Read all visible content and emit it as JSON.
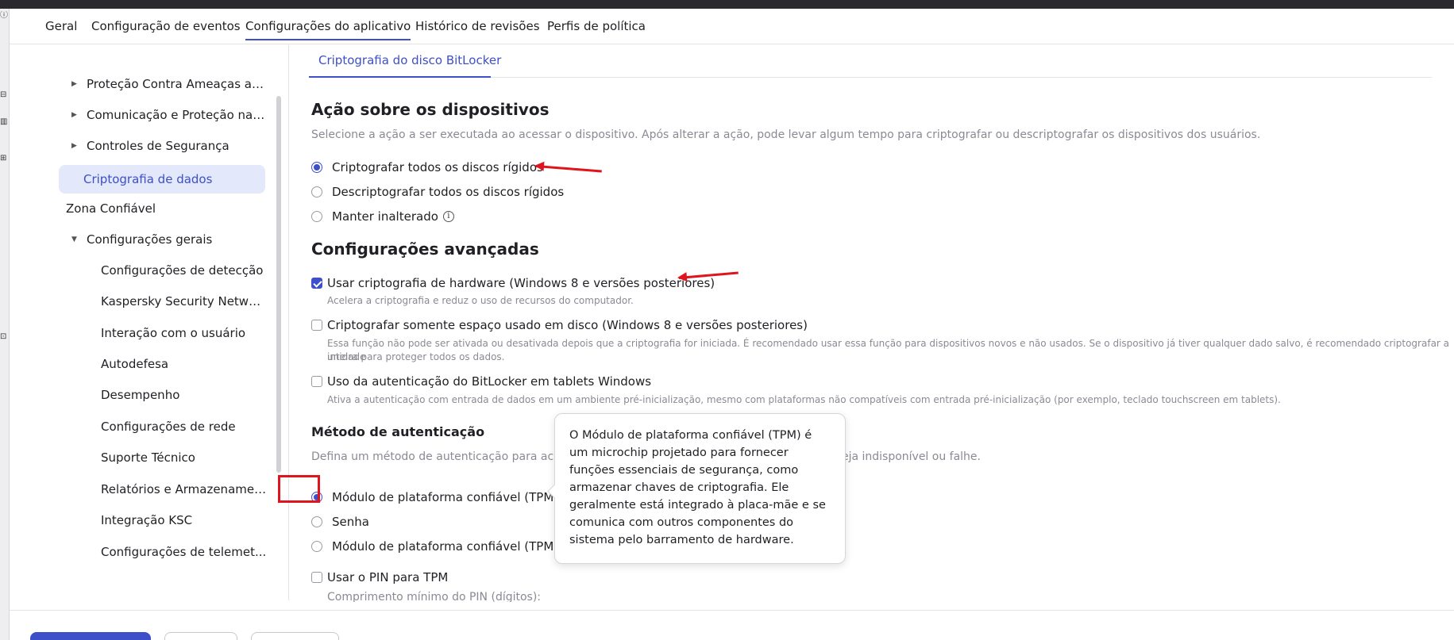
{
  "tabs": [
    {
      "label": "Geral"
    },
    {
      "label": "Configuração de eventos"
    },
    {
      "label": "Configurações do aplicativo"
    },
    {
      "label": "Histórico de revisões"
    },
    {
      "label": "Perfis de política"
    }
  ],
  "tree": [
    {
      "label": "Proteção Contra Ameaças ao..."
    },
    {
      "label": "Comunicação e Proteção na ..."
    },
    {
      "label": "Controles de Segurança"
    },
    {
      "label": "Criptografia de dados"
    },
    {
      "label": "Zona Confiável"
    },
    {
      "label": "Configurações gerais"
    },
    {
      "label": "Configurações de detecção"
    },
    {
      "label": "Kaspersky Security Network"
    },
    {
      "label": "Interação com o usuário"
    },
    {
      "label": "Autodefesa"
    },
    {
      "label": "Desempenho"
    },
    {
      "label": "Configurações de rede"
    },
    {
      "label": "Suporte Técnico"
    },
    {
      "label": "Relatórios e Armazenamen..."
    },
    {
      "label": "Integração KSC"
    },
    {
      "label": "Configurações de telemet..."
    }
  ],
  "content": {
    "subtab": "Criptografia do disco BitLocker",
    "device_action": {
      "title": "Ação sobre os dispositivos",
      "description": "Selecione a ação a ser executada ao acessar o dispositivo. Após alterar a ação, pode levar algum tempo para criptografar ou descriptografar os dispositivos dos usuários.",
      "options": [
        {
          "label": "Criptografar todos os discos rígidos",
          "checked": true
        },
        {
          "label": "Descriptografar todos os discos rígidos",
          "checked": false
        },
        {
          "label": "Manter inalterado",
          "checked": false
        }
      ]
    },
    "advanced": {
      "title": "Configurações avançadas",
      "items": [
        {
          "label": "Usar criptografia de hardware (Windows 8 e versões posteriores)",
          "checked": true,
          "hint": "Acelera a criptografia e reduz o uso de recursos do computador."
        },
        {
          "label": "Criptografar somente espaço usado em disco (Windows 8 e versões posteriores)",
          "checked": false,
          "hint_line1": "Essa função não pode ser ativada ou desativada depois que a criptografia for iniciada. É recomendado usar essa função para dispositivos novos e não usados. Se o dispositivo já tiver qualquer dado salvo, é recomendado criptografar a unidade",
          "hint_line2": "inteira para proteger todos os dados."
        },
        {
          "label": "Uso da autenticação do BitLocker em tablets Windows",
          "checked": false,
          "hint": "Ativa a autenticação com entrada de dados em um ambiente pré-inicialização, mesmo com plataformas não compatíveis com entrada pré-inicialização (por exemplo, teclado touchscreen em tablets)."
        }
      ]
    },
    "auth": {
      "title": "Método de autenticação",
      "description_left": "Defina um método de autenticação para acess",
      "description_right": "o o TPM esteja indisponível ou falhe.",
      "options": [
        {
          "label": "Módulo de plataforma confiável (TPM)",
          "checked": true
        },
        {
          "label": "Senha",
          "checked": false
        },
        {
          "label": "Módulo de plataforma confiável (TPM), ou s",
          "checked": false
        }
      ],
      "pin_checkbox": "Usar o PIN para TPM",
      "pin_length": "Comprimento mínimo do PIN (dígitos):"
    },
    "tooltip": "O Módulo de plataforma confiável (TPM) é um microchip projetado para fornecer funções essenciais de segurança, como armazenar chaves de criptografia. Ele geralmente está integrado à placa-mãe e se comunica com outros componentes do sistema pelo barramento de hardware."
  },
  "colors": {
    "accent": "#3d4fc9",
    "annotation": "#e0141c"
  }
}
